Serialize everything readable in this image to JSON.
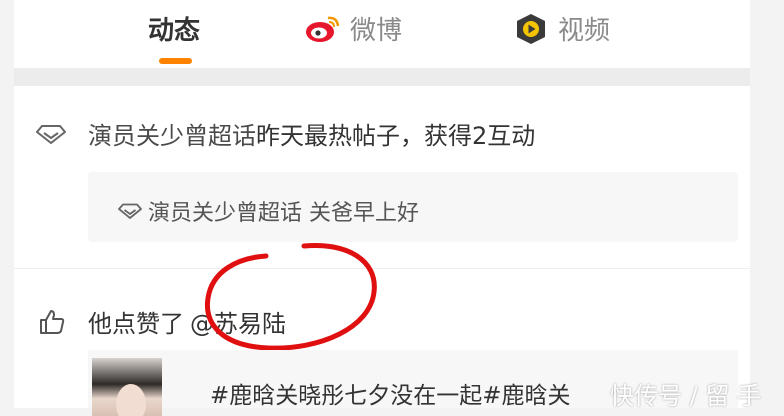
{
  "tabs": [
    {
      "label": "动态"
    },
    {
      "label": "微博"
    },
    {
      "label": "视频"
    }
  ],
  "activities": [
    {
      "icon": "diamond-icon",
      "prefix": "演员关少曾超话",
      "text": "昨天最热帖子，获得2互动",
      "card_text": "演员关少曾超话 关爸早上好"
    },
    {
      "icon": "like-icon",
      "text": "他点赞了",
      "mention": "@苏易陆",
      "card_text": "#鹿晗关晓彤七夕没在一起#鹿晗关"
    }
  ],
  "watermark": "快传号 / 留 手",
  "colors": {
    "accent": "#ff8200",
    "circle": "#e01010"
  }
}
